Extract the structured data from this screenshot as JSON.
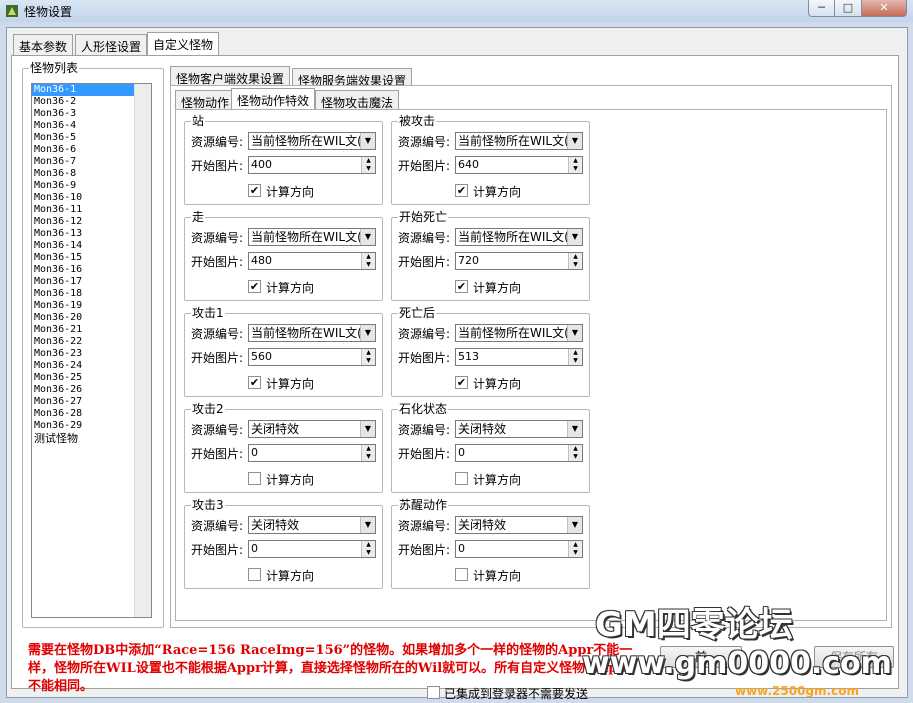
{
  "window": {
    "title": "怪物设置",
    "close_glyph": "✕",
    "min_glyph": "─",
    "max_glyph": "□"
  },
  "outer_tabs": [
    "基本参数",
    "人形怪设置",
    "自定义怪物"
  ],
  "monster_list": {
    "title": "怪物列表",
    "items": [
      "Mon36-1",
      "Mon36-2",
      "Mon36-3",
      "Mon36-4",
      "Mon36-5",
      "Mon36-6",
      "Mon36-7",
      "Mon36-8",
      "Mon36-9",
      "Mon36-10",
      "Mon36-11",
      "Mon36-12",
      "Mon36-13",
      "Mon36-14",
      "Mon36-15",
      "Mon36-16",
      "Mon36-17",
      "Mon36-18",
      "Mon36-19",
      "Mon36-20",
      "Mon36-21",
      "Mon36-22",
      "Mon36-23",
      "Mon36-24",
      "Mon36-25",
      "Mon36-26",
      "Mon36-27",
      "Mon36-28",
      "Mon36-29"
    ],
    "extra_item": "测试怪物"
  },
  "effect_tabs": [
    "怪物客户端效果设置",
    "怪物服务端效果设置"
  ],
  "inner_tabs": [
    "怪物动作",
    "怪物动作特效",
    "怪物攻击魔法"
  ],
  "labels": {
    "resource": "资源编号:",
    "start_image": "开始图片:",
    "calc_direction": "计算方向"
  },
  "groups": [
    {
      "title": "站",
      "resource": "当前怪物所在WIL文(",
      "start": "400",
      "calc": true
    },
    {
      "title": "被攻击",
      "resource": "当前怪物所在WIL文(",
      "start": "640",
      "calc": true
    },
    {
      "title": "走",
      "resource": "当前怪物所在WIL文(",
      "start": "480",
      "calc": true
    },
    {
      "title": "开始死亡",
      "resource": "当前怪物所在WIL文(",
      "start": "720",
      "calc": true
    },
    {
      "title": "攻击1",
      "resource": "当前怪物所在WIL文(",
      "start": "560",
      "calc": true
    },
    {
      "title": "死亡后",
      "resource": "当前怪物所在WIL文(",
      "start": "513",
      "calc": true
    },
    {
      "title": "攻击2",
      "resource": "关闭特效",
      "start": "0",
      "calc": false
    },
    {
      "title": "石化状态",
      "resource": "关闭特效",
      "start": "0",
      "calc": false
    },
    {
      "title": "攻击3",
      "resource": "关闭特效",
      "start": "0",
      "calc": false
    },
    {
      "title": "苏醒动作",
      "resource": "关闭特效",
      "start": "0",
      "calc": false
    }
  ],
  "note": "需要在怪物DB中添加“Race=156 RaceImg=156”的怪物。如果增加多个一样的怪物的Appr不能一样，怪物所在WIL设置也不能根据Appr计算，直接选择怪物所在的Wil就可以。所有自定义怪物的Appr不能相同。",
  "bottom_checkbox": "已集成到登录器不需要发送",
  "buttons": {
    "save_all": "保存所有",
    "apply_current": "前"
  },
  "watermark": {
    "forum": "GM四零论坛",
    "url": "www.gm0000.com",
    "sub": "www.2500gm.com"
  }
}
